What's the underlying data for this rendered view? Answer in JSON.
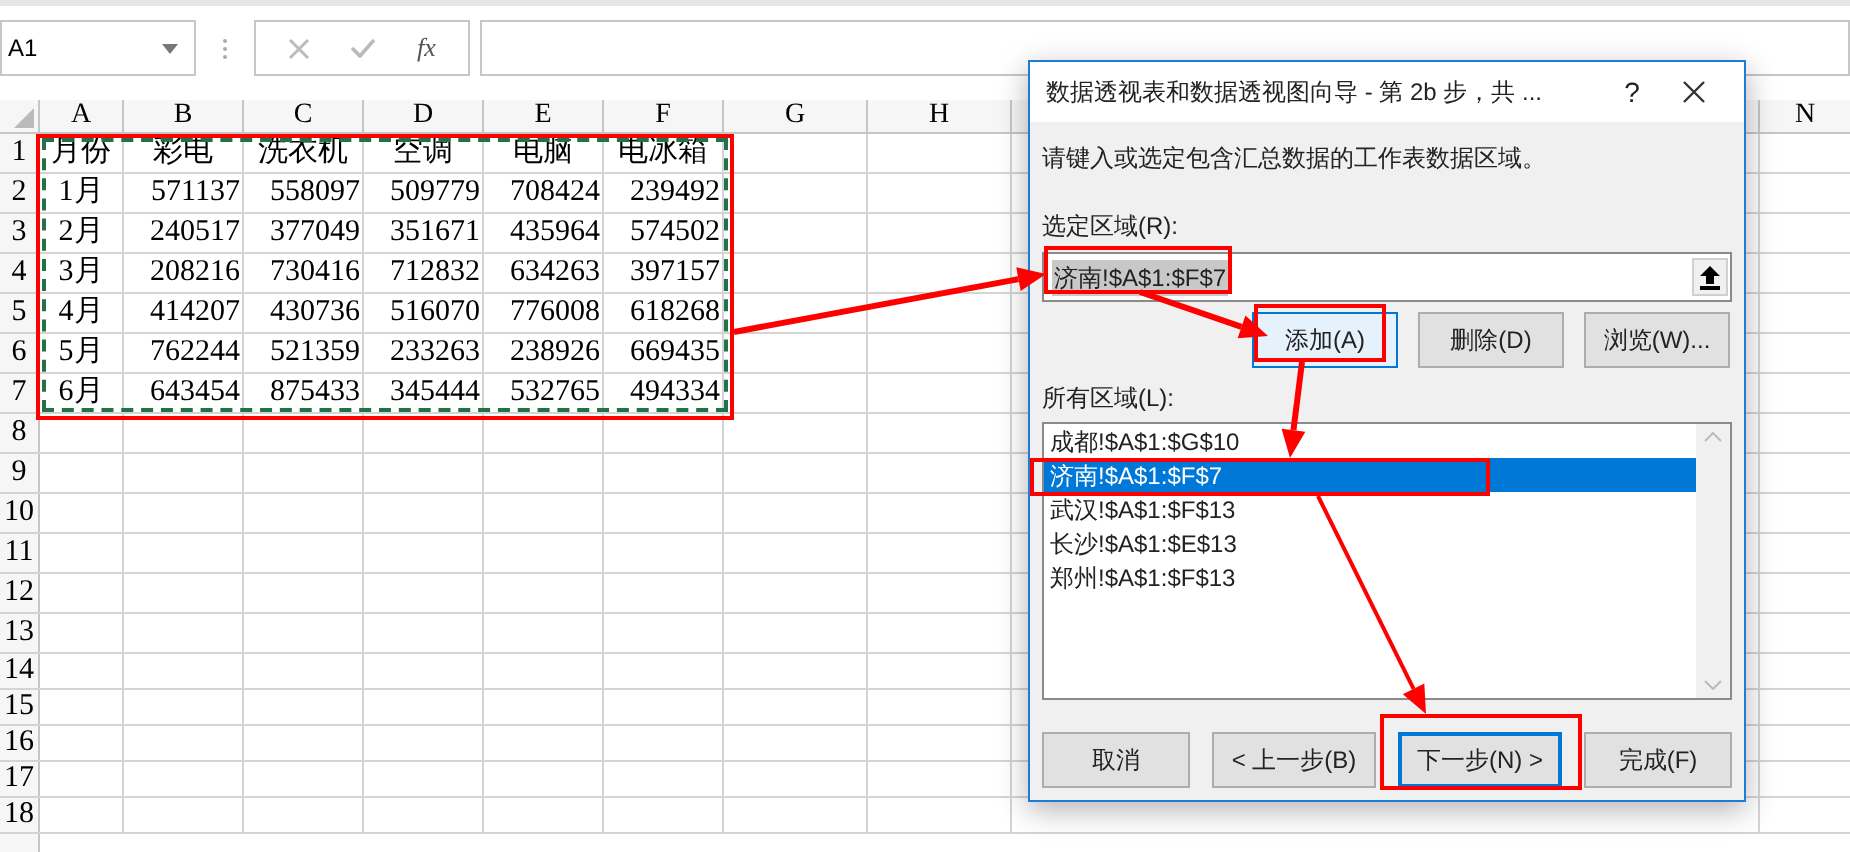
{
  "name_box": {
    "value": "A1"
  },
  "formula_bar": {
    "function_label": "fx"
  },
  "sheet": {
    "columns": [
      {
        "label": "A"
      },
      {
        "label": "B"
      },
      {
        "label": "C"
      },
      {
        "label": "D"
      },
      {
        "label": "E"
      },
      {
        "label": "F"
      },
      {
        "label": "G"
      },
      {
        "label": "H"
      },
      {
        "label": "N"
      }
    ],
    "rows": [
      {
        "number": "1",
        "cells": [
          "月份",
          "彩电",
          "洗衣机",
          "空调",
          "电脑",
          "电冰箱"
        ]
      },
      {
        "number": "2",
        "cells": [
          "1月",
          "571137",
          "558097",
          "509779",
          "708424",
          "239492"
        ]
      },
      {
        "number": "3",
        "cells": [
          "2月",
          "240517",
          "377049",
          "351671",
          "435964",
          "574502"
        ]
      },
      {
        "number": "4",
        "cells": [
          "3月",
          "208216",
          "730416",
          "712832",
          "634263",
          "397157"
        ]
      },
      {
        "number": "5",
        "cells": [
          "4月",
          "414207",
          "430736",
          "516070",
          "776008",
          "618268"
        ]
      },
      {
        "number": "6",
        "cells": [
          "5月",
          "762244",
          "521359",
          "233263",
          "238926",
          "669435"
        ]
      },
      {
        "number": "7",
        "cells": [
          "6月",
          "643454",
          "875433",
          "345444",
          "532765",
          "494334"
        ]
      },
      {
        "number": "8",
        "cells": []
      },
      {
        "number": "9",
        "cells": []
      },
      {
        "number": "10",
        "cells": []
      },
      {
        "number": "11",
        "cells": []
      },
      {
        "number": "12",
        "cells": []
      },
      {
        "number": "13",
        "cells": []
      },
      {
        "number": "14",
        "cells": []
      },
      {
        "number": "15",
        "cells": []
      },
      {
        "number": "16",
        "cells": []
      },
      {
        "number": "17",
        "cells": []
      },
      {
        "number": "18",
        "cells": []
      }
    ]
  },
  "dialog": {
    "title": "数据透视表和数据透视图向导 - 第 2b 步，共 ...",
    "help": "?",
    "intro": "请键入或选定包含汇总数据的工作表数据区域。",
    "range_label": "选定区域(R):",
    "range_value": "济南!$A$1:$F$7",
    "range_buttons": [
      {
        "label": "添加(A)",
        "highlighted": true
      },
      {
        "label": "删除(D)",
        "highlighted": false
      },
      {
        "label": "浏览(W)...",
        "highlighted": false
      }
    ],
    "all_ranges_label": "所有区域(L):",
    "ranges": [
      {
        "label": "成都!$A$1:$G$10",
        "selected": false
      },
      {
        "label": "济南!$A$1:$F$7",
        "selected": true
      },
      {
        "label": "武汉!$A$1:$F$13",
        "selected": false
      },
      {
        "label": "长沙!$A$1:$E$13",
        "selected": false
      },
      {
        "label": "郑州!$A$1:$F$13",
        "selected": false
      }
    ],
    "footer_buttons": [
      {
        "label": "取消",
        "default": false
      },
      {
        "label": "< 上一步(B)",
        "default": false
      },
      {
        "label": "下一步(N) >",
        "default": true
      },
      {
        "label": "完成(F)",
        "default": false
      }
    ]
  }
}
